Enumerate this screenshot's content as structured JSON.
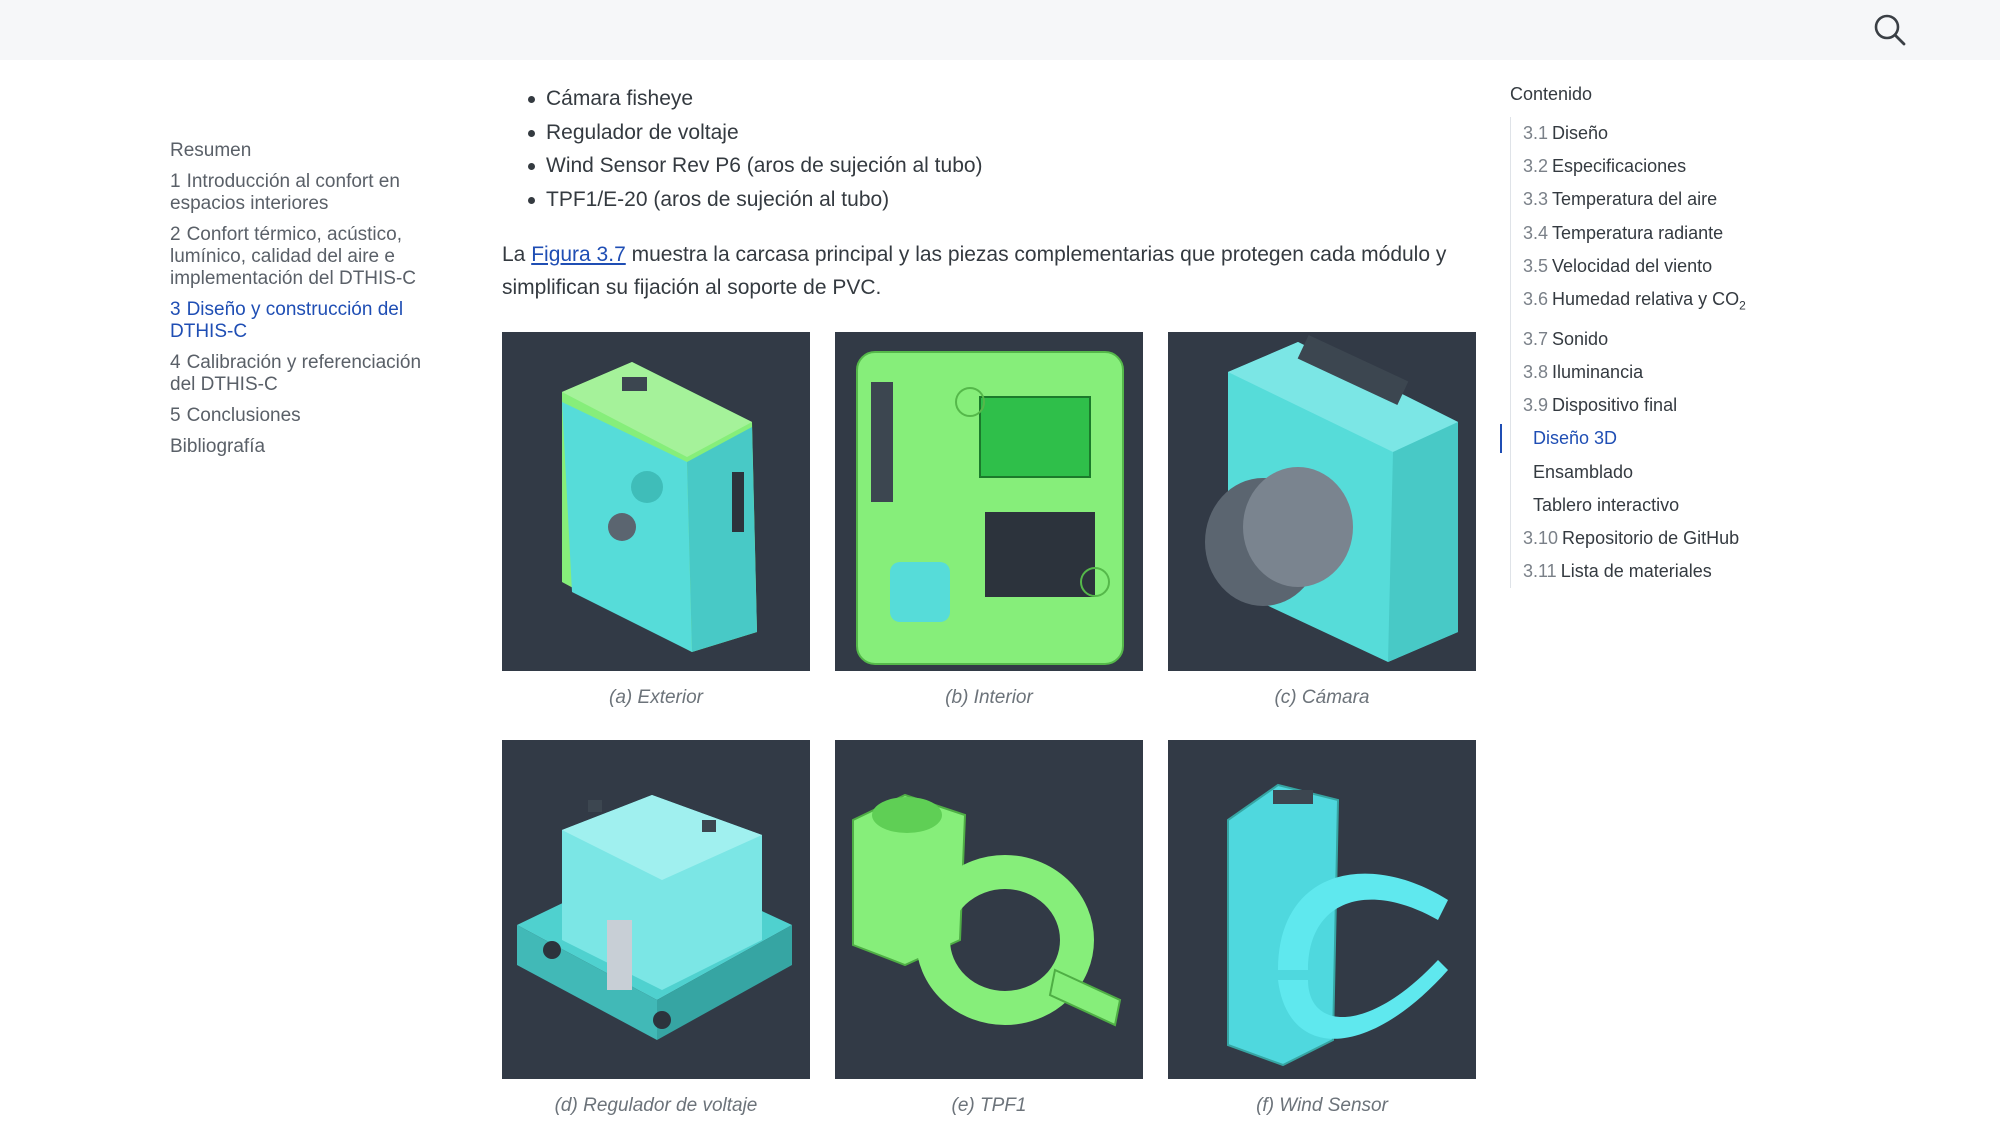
{
  "header": {
    "search_icon": "search-icon"
  },
  "sidebar": {
    "items": [
      {
        "num": "",
        "label": "Resumen"
      },
      {
        "num": "1",
        "label": "Introducción al confort en espacios interiores"
      },
      {
        "num": "2",
        "label": "Confort térmico, acústico, lumínico, calidad del aire e implementación del DTHIS-C"
      },
      {
        "num": "3",
        "label": "Diseño y construcción del DTHIS-C"
      },
      {
        "num": "4",
        "label": "Calibración y referenciación del DTHIS-C"
      },
      {
        "num": "5",
        "label": "Conclusiones"
      },
      {
        "num": "",
        "label": "Bibliografía"
      }
    ],
    "active_index": 3
  },
  "main": {
    "bullets": [
      "Cámara fisheye",
      "Regulador de voltaje",
      "Wind Sensor Rev P6 (aros de sujeción al tubo)",
      "TPF1/E-20 (aros de sujeción al tubo)"
    ],
    "para_pre": "La ",
    "para_link": "Figura 3.7",
    "para_post": " muestra la carcasa principal y las piezas complementarias que protegen cada módulo y simplifican su fijación al soporte de PVC.",
    "figures": [
      {
        "caption": "(a) Exterior"
      },
      {
        "caption": "(b) Interior"
      },
      {
        "caption": "(c) Cámara"
      },
      {
        "caption": "(d) Regulador de voltaje"
      },
      {
        "caption": "(e) TPF1"
      },
      {
        "caption": "(f) Wind Sensor"
      }
    ]
  },
  "toc": {
    "title": "Contenido",
    "items": [
      {
        "num": "3.1",
        "label": "Diseño"
      },
      {
        "num": "3.2",
        "label": "Especificaciones"
      },
      {
        "num": "3.3",
        "label": "Temperatura del aire"
      },
      {
        "num": "3.4",
        "label": "Temperatura radiante"
      },
      {
        "num": "3.5",
        "label": "Velocidad del viento"
      },
      {
        "num": "3.6",
        "label": "Humedad relativa y CO",
        "sub": "2"
      },
      {
        "num": "3.7",
        "label": "Sonido"
      },
      {
        "num": "3.8",
        "label": "Iluminancia"
      },
      {
        "num": "3.9",
        "label": "Dispositivo final"
      },
      {
        "num": "",
        "label": "Diseño 3D"
      },
      {
        "num": "",
        "label": "Ensamblado"
      },
      {
        "num": "",
        "label": "Tablero interactivo"
      },
      {
        "num": "3.10",
        "label": "Repositorio de GitHub"
      },
      {
        "num": "3.11",
        "label": "Lista de materiales"
      }
    ]
  },
  "colors": {
    "accent": "#1f4eb4",
    "panel_bg": "#323a46",
    "cyan_part": "#4fd8de",
    "green_part": "#86ee7a"
  }
}
